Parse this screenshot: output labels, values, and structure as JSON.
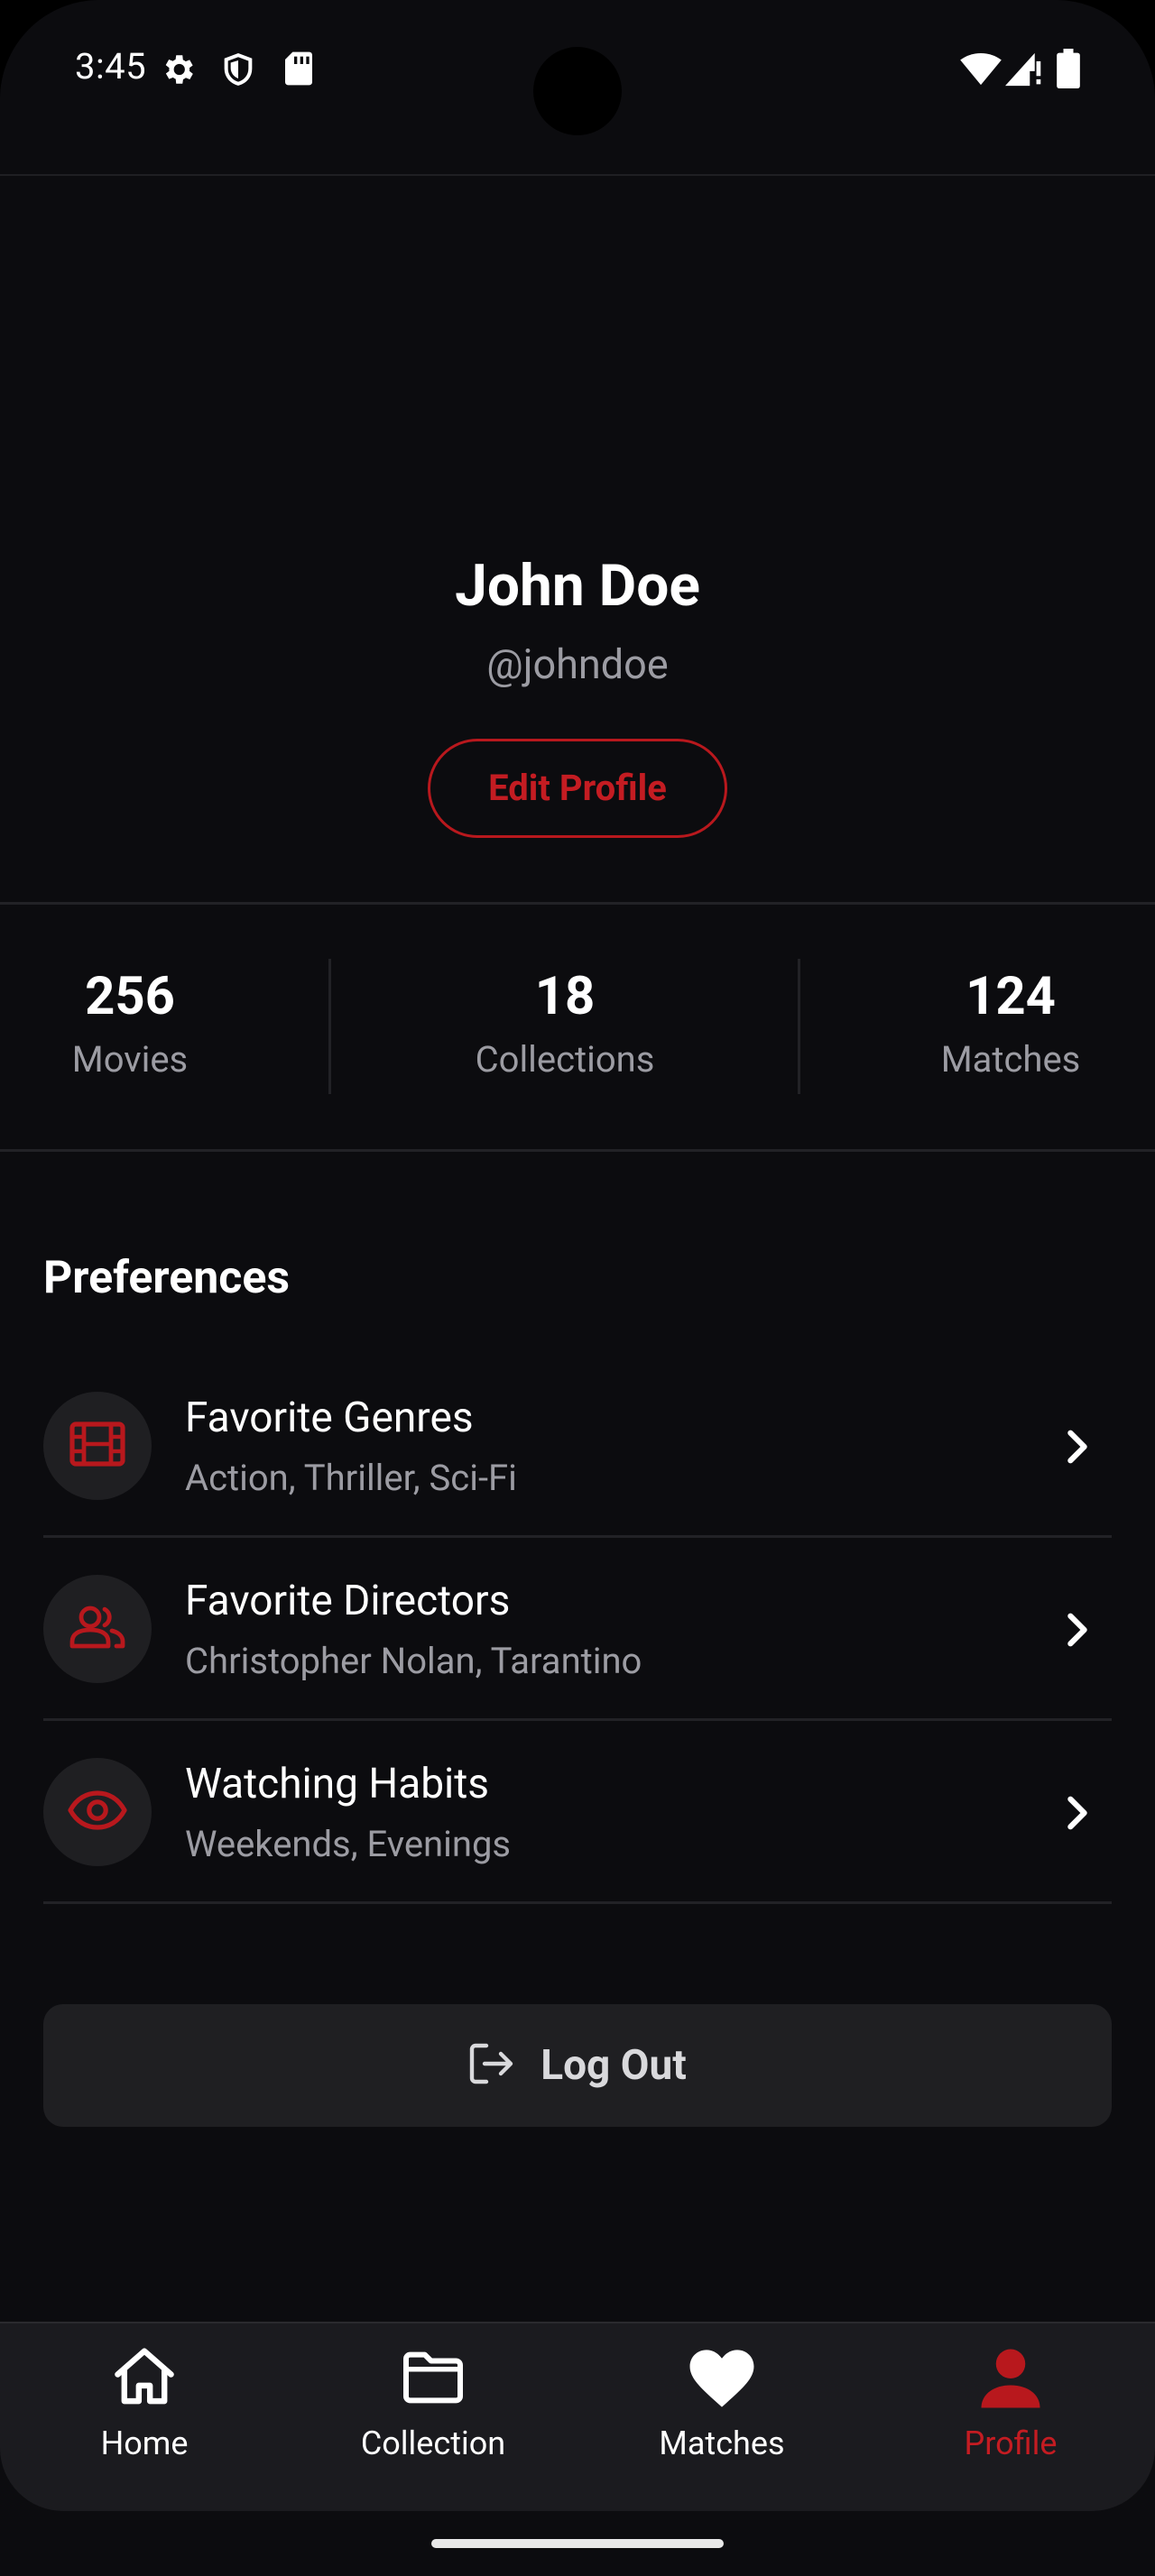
{
  "status_bar": {
    "time": "3:45"
  },
  "profile": {
    "name": "John Doe",
    "handle": "@johndoe",
    "edit_label": "Edit Profile"
  },
  "stats": [
    {
      "value": "256",
      "label": "Movies"
    },
    {
      "value": "18",
      "label": "Collections"
    },
    {
      "value": "124",
      "label": "Matches"
    }
  ],
  "preferences": {
    "title": "Preferences",
    "items": [
      {
        "title": "Favorite Genres",
        "subtitle": "Action, Thriller, Sci-Fi",
        "icon": "film-icon"
      },
      {
        "title": "Favorite Directors",
        "subtitle": "Christopher Nolan, Tarantino",
        "icon": "people-icon"
      },
      {
        "title": "Watching Habits",
        "subtitle": "Weekends, Evenings",
        "icon": "eye-icon"
      }
    ]
  },
  "logout": {
    "label": "Log Out"
  },
  "nav": {
    "items": [
      {
        "label": "Home",
        "icon": "home-icon",
        "active": false
      },
      {
        "label": "Collection",
        "icon": "folder-icon",
        "active": false
      },
      {
        "label": "Matches",
        "icon": "heart-icon",
        "active": false
      },
      {
        "label": "Profile",
        "icon": "person-icon",
        "active": true
      }
    ]
  },
  "colors": {
    "background": "#0c0c0f",
    "accent": "#c41c22",
    "surface": "#1f1f22",
    "muted_text": "#9c9ca3"
  }
}
